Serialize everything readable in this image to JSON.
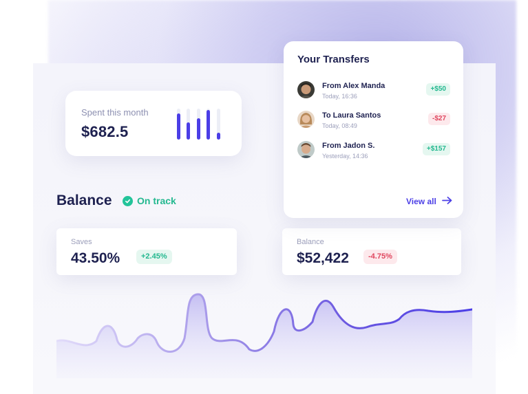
{
  "spent": {
    "label": "Spent this month",
    "amount": "$682.5",
    "bar_levels": [
      0.85,
      0.55,
      0.7,
      0.95,
      0.22
    ]
  },
  "balance_section": {
    "title": "Balance",
    "status": "On track"
  },
  "stats": [
    {
      "label": "Saves",
      "value": "43.50%",
      "change": "+2.45%",
      "trend": "positive"
    },
    {
      "label": "Balance",
      "value": "$52,422",
      "change": "-4.75%",
      "trend": "negative"
    }
  ],
  "transfers": {
    "title": "Your Transfers",
    "items": [
      {
        "name": "From Alex Manda",
        "date": "Today, 16:36",
        "amount": "+$50",
        "trend": "positive",
        "avatar": "avatar-icon"
      },
      {
        "name": "To Laura Santos",
        "date": "Today, 08:49",
        "amount": "-$27",
        "trend": "negative",
        "avatar": "avatar-icon"
      },
      {
        "name": "From Jadon S.",
        "date": "Yesterday, 14:36",
        "amount": "+$157",
        "trend": "positive",
        "avatar": "avatar-icon"
      }
    ],
    "view_all": "View all"
  },
  "colors": {
    "accent": "#4b3ee6",
    "positive": "#23b88f",
    "negative": "#e0465e",
    "heading": "#1e2150",
    "muted": "#9b9eba"
  }
}
